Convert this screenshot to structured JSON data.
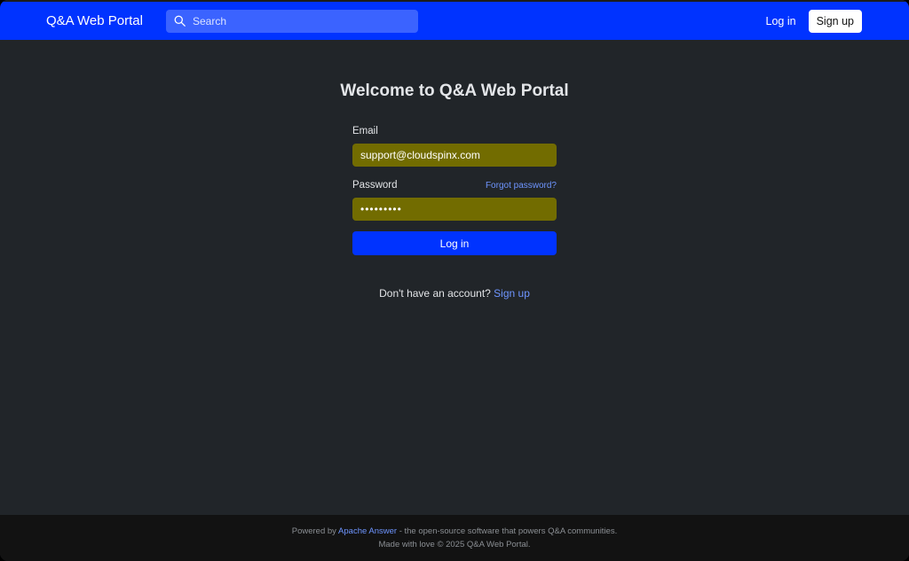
{
  "navbar": {
    "brand": "Q&A Web Portal",
    "search_placeholder": "Search",
    "login_label": "Log in",
    "signup_label": "Sign up"
  },
  "main": {
    "title": "Welcome to Q&A Web Portal",
    "email_label": "Email",
    "email_value": "support@cloudspinx.com",
    "password_label": "Password",
    "forgot_label": "Forgot password?",
    "password_masked": "•••••••••",
    "login_button": "Log in",
    "no_account_text": "Don't have an account?",
    "signup_link": "Sign up"
  },
  "footer": {
    "powered_prefix": "Powered by",
    "powered_link": "Apache Answer",
    "powered_suffix": "- the open-source software that powers Q&A communities.",
    "made_with": "Made with love © 2025 Q&A Web Portal."
  },
  "colors": {
    "navbar_bg": "#0033ff",
    "page_bg": "#212529",
    "autofill_bg": "#726c00",
    "link": "#6e95ff",
    "footer_bg": "#121212"
  },
  "icons": {
    "search": "search-icon"
  }
}
